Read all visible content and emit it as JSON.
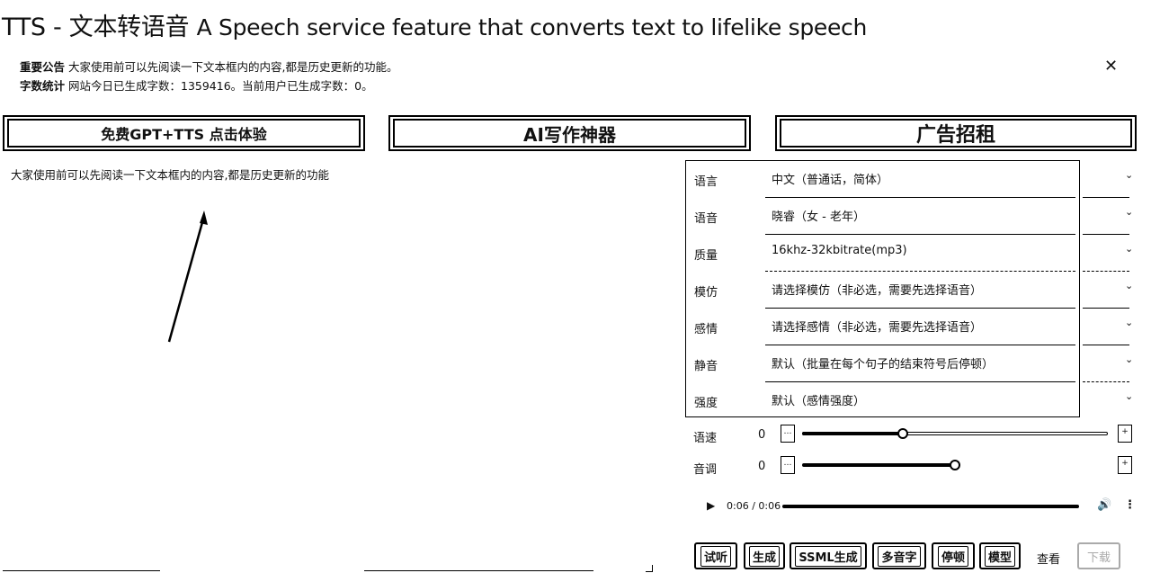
{
  "header": {
    "title_main": "TTS - 文本转语音",
    "title_sub": "A Speech service feature that converts text to lifelike speech"
  },
  "notice": {
    "line1_label": "重要公告",
    "line1_text": "大家使用前可以先阅读一下文本框内的内容,都是历史更新的功能。",
    "line2_label": "字数统计",
    "line2_text": "网站今日已生成字数：1359416。当前用户已生成字数：0。",
    "close_symbol": "✕"
  },
  "banners": {
    "b1": "免费GPT+TTS 点击体验",
    "b2": "AI写作神器",
    "b3": "广告招租"
  },
  "editor": {
    "content": "大家使用前可以先阅读一下文本框内的内容,都是历史更新的功能"
  },
  "settings": {
    "rows": [
      {
        "label": "语言",
        "value": "中文（普通话，简体）"
      },
      {
        "label": "语音",
        "value": "晓睿（女 - 老年）"
      },
      {
        "label": "质量",
        "value": "16khz-32kbitrate(mp3)"
      },
      {
        "label": "模仿",
        "value": "请选择模仿（非必选，需要先选择语音）"
      },
      {
        "label": "感情",
        "value": "请选择感情（非必选，需要先选择语音）"
      },
      {
        "label": "静音",
        "value": "默认（likely 批量在每个句子的结束符号后停顿）"
      },
      {
        "label": "强度",
        "value": "默认（感情强度）"
      }
    ],
    "chevron": "⌄"
  },
  "sliders": {
    "speed": {
      "label": "语速",
      "value": "0",
      "level": 0.33
    },
    "pitch": {
      "label": "音调",
      "value": "0",
      "level": 0.5
    }
  },
  "audio": {
    "time": "0:06 / 0:06",
    "progress": 1.0
  },
  "buttons": {
    "listen": "试听",
    "generate": "生成",
    "ssml": "SSML生成",
    "multi": "多音字",
    "pause": "停顿",
    "model": "模型",
    "view": "查看",
    "disabled": "下载"
  }
}
